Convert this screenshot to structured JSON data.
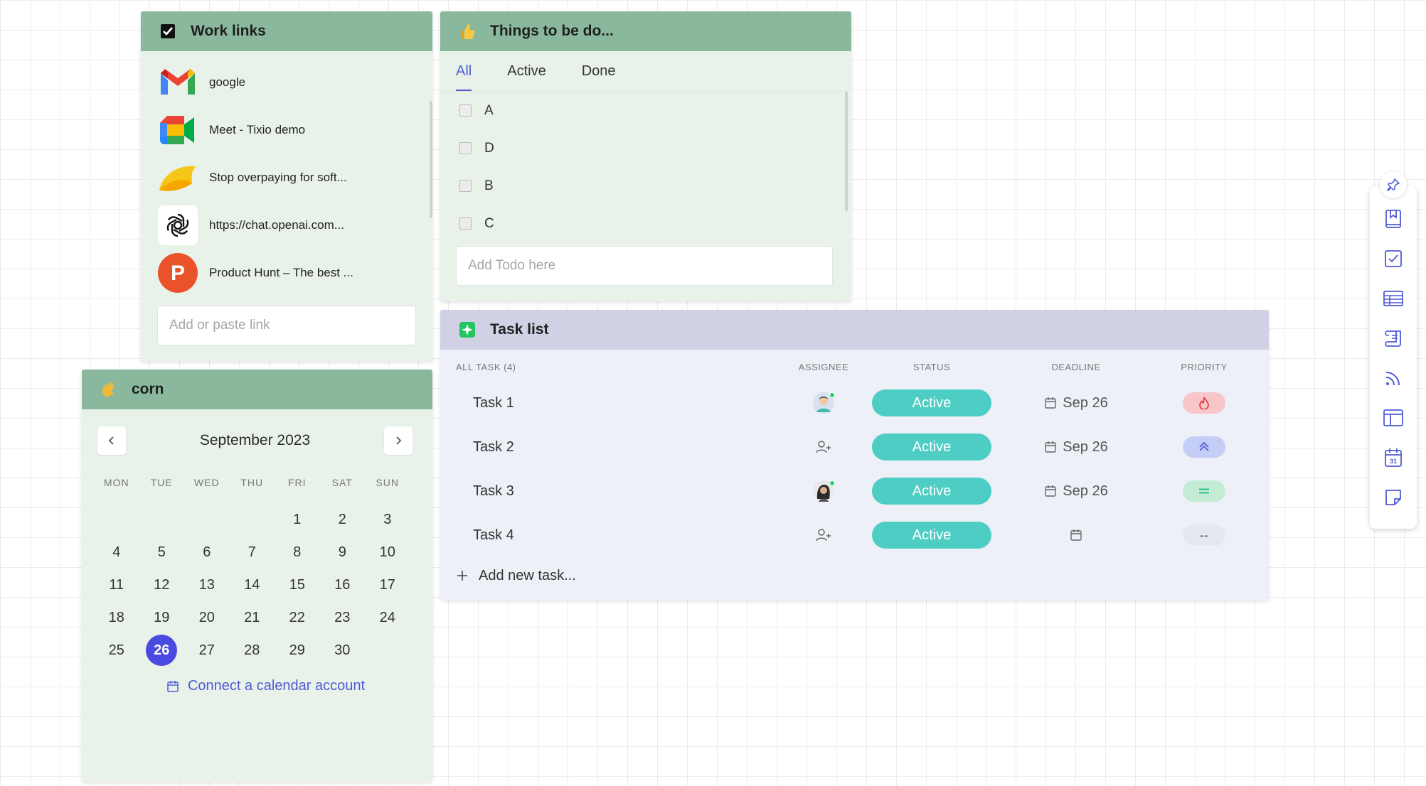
{
  "work_links": {
    "title": "Work links",
    "items": [
      {
        "label": "google",
        "icon": "gmail-icon"
      },
      {
        "label": "Meet - Tixio demo",
        "icon": "google-meet-icon"
      },
      {
        "label": "Stop overpaying for soft...",
        "icon": "yellow-swoosh-icon"
      },
      {
        "label": "https://chat.openai.com...",
        "icon": "openai-icon"
      },
      {
        "label": "Product Hunt – The best ...",
        "icon": "product-hunt-icon"
      }
    ],
    "input_placeholder": "Add or paste link"
  },
  "todo": {
    "title": "Things to be do...",
    "tabs": [
      "All",
      "Active",
      "Done"
    ],
    "active_tab": "All",
    "items": [
      "A",
      "D",
      "B",
      "C"
    ],
    "input_placeholder": "Add Todo here"
  },
  "calendar": {
    "title": "corn",
    "month_label": "September 2023",
    "weekdays": [
      "MON",
      "TUE",
      "WED",
      "THU",
      "FRI",
      "SAT",
      "SUN"
    ],
    "weeks": [
      [
        "",
        "",
        "",
        "",
        "1",
        "2",
        "3"
      ],
      [
        "4",
        "5",
        "6",
        "7",
        "8",
        "9",
        "10"
      ],
      [
        "11",
        "12",
        "13",
        "14",
        "15",
        "16",
        "17"
      ],
      [
        "18",
        "19",
        "20",
        "21",
        "22",
        "23",
        "24"
      ],
      [
        "25",
        "26",
        "27",
        "28",
        "29",
        "30",
        ""
      ]
    ],
    "today": "26",
    "connect_label": "Connect a calendar account"
  },
  "task_list": {
    "title": "Task list",
    "columns": {
      "name": "ALL TASK (4)",
      "assignee": "ASSIGNEE",
      "status": "STATUS",
      "deadline": "DEADLINE",
      "priority": "PRIORITY"
    },
    "rows": [
      {
        "name": "Task 1",
        "assignee": "avatar-man",
        "status": "Active",
        "deadline": "Sep 26",
        "priority": "urgent",
        "priority_text": ""
      },
      {
        "name": "Task 2",
        "assignee": "unassigned",
        "status": "Active",
        "deadline": "Sep 26",
        "priority": "high",
        "priority_text": ""
      },
      {
        "name": "Task 3",
        "assignee": "avatar-woman",
        "status": "Active",
        "deadline": "Sep 26",
        "priority": "medium",
        "priority_text": ""
      },
      {
        "name": "Task 4",
        "assignee": "unassigned",
        "status": "Active",
        "deadline": "",
        "priority": "none",
        "priority_text": "--"
      }
    ],
    "add_label": "Add new task..."
  },
  "toolbar": {
    "icons": [
      "pin-icon",
      "bookmark-icon",
      "checkbox-icon",
      "table-icon",
      "scroll-icon",
      "rss-icon",
      "layout-icon",
      "calendar-icon",
      "sticky-note-icon"
    ]
  },
  "colors": {
    "widget_header_green": "#8ab89c",
    "widget_body_green": "#e8f2e9",
    "tasklist_header": "#d0d1e4",
    "status_active": "#4ecdc4",
    "accent_blue": "#4f5bd5",
    "today_circle": "#4a4ae0"
  }
}
